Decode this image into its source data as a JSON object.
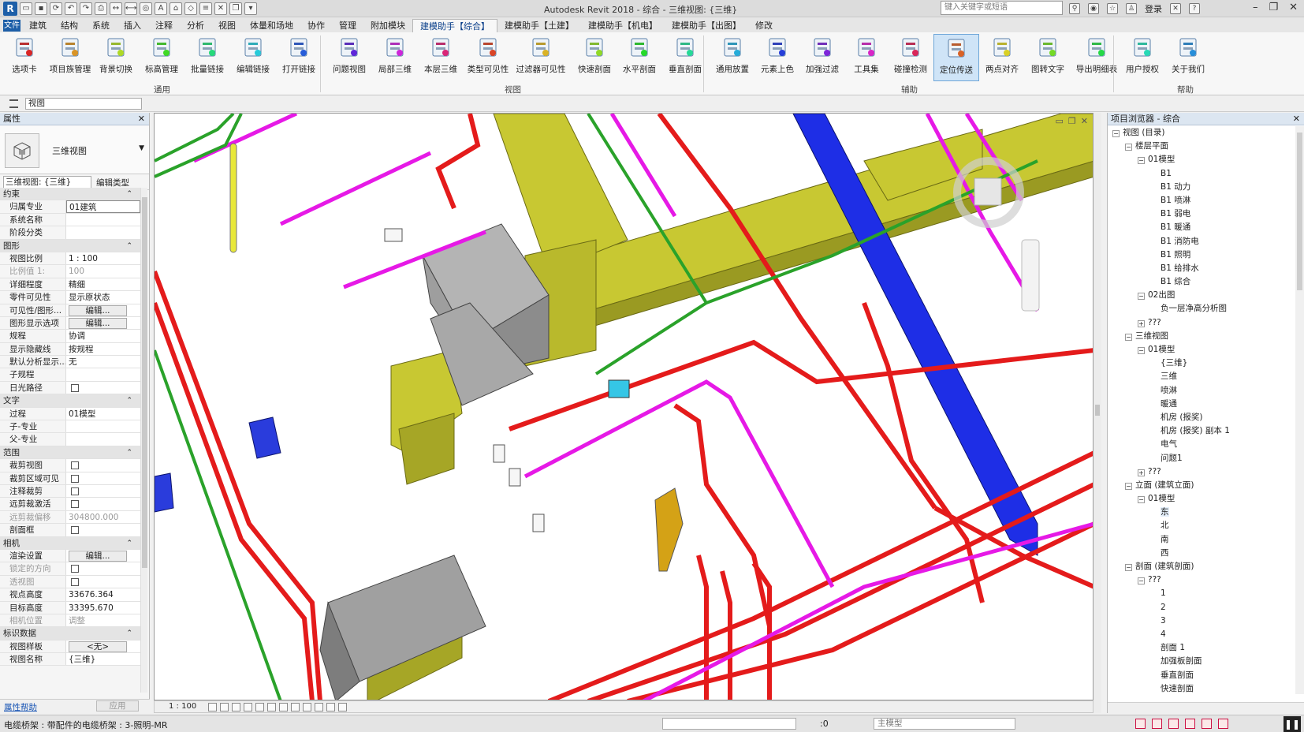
{
  "app": {
    "title": "Autodesk Revit 2018 -    综合 - 三维视图: {三维}",
    "search_placeholder": "键入关键字或短语",
    "login": "登录"
  },
  "tabs": [
    "建筑",
    "结构",
    "系统",
    "插入",
    "注释",
    "分析",
    "视图",
    "体量和场地",
    "协作",
    "管理",
    "附加模块",
    "建模助手【综合】",
    "建模助手【土建】",
    "建模助手【机电】",
    "建模助手【出图】",
    "修改"
  ],
  "active_tab": "建模助手【综合】",
  "ribbon": {
    "buttons": [
      {
        "label": "选项卡",
        "icon": "tab-icon"
      },
      {
        "label": "项目族管理",
        "icon": "family-manager-icon"
      },
      {
        "label": "背景切换",
        "icon": "background-switch-icon"
      },
      {
        "label": "标高管理",
        "icon": "level-manager-icon"
      },
      {
        "label": "批量链接",
        "icon": "batch-link-icon"
      },
      {
        "label": "编辑链接",
        "icon": "edit-link-icon"
      },
      {
        "label": "打开链接",
        "icon": "open-link-icon"
      },
      {
        "label": "问题视图",
        "icon": "issue-view-icon"
      },
      {
        "label": "局部三维",
        "icon": "local-3d-icon"
      },
      {
        "label": "本层三维",
        "icon": "floor-3d-icon"
      },
      {
        "label": "类型可见性",
        "icon": "type-visibility-icon"
      },
      {
        "label": "过滤器可见性",
        "icon": "filter-visibility-icon"
      },
      {
        "label": "快速剖面",
        "icon": "quick-section-icon"
      },
      {
        "label": "水平剖面",
        "icon": "horizontal-section-icon"
      },
      {
        "label": "垂直剖面",
        "icon": "vertical-section-icon"
      },
      {
        "label": "通用放置",
        "icon": "general-place-icon"
      },
      {
        "label": "元素上色",
        "icon": "element-color-icon"
      },
      {
        "label": "加强过滤",
        "icon": "enhanced-filter-icon"
      },
      {
        "label": "工具集",
        "icon": "toolbox-icon"
      },
      {
        "label": "碰撞检测",
        "icon": "clash-detect-icon"
      },
      {
        "label": "定位传送",
        "icon": "locate-teleport-icon"
      },
      {
        "label": "两点对齐",
        "icon": "two-point-align-icon"
      },
      {
        "label": "图转文字",
        "icon": "image-to-text-icon"
      },
      {
        "label": "导出明细表",
        "icon": "export-schedule-icon"
      },
      {
        "label": "用户授权",
        "icon": "user-license-icon"
      },
      {
        "label": "关于我们",
        "icon": "about-us-icon"
      }
    ],
    "active_button": "定位传送",
    "groups": [
      "通用",
      "视图",
      "辅助",
      "帮助"
    ]
  },
  "optionbar": {
    "view_select": "视图"
  },
  "properties": {
    "title": "属性",
    "type_name": "三维视图",
    "type_select": "三维视图: {三维}",
    "edit_type": "编辑类型",
    "rows": [
      {
        "section": "约束"
      },
      {
        "k": "归属专业",
        "v": "01建筑",
        "boxed": true
      },
      {
        "k": "系统名称",
        "v": ""
      },
      {
        "k": "阶段分类",
        "v": ""
      },
      {
        "section": "图形"
      },
      {
        "k": "视图比例",
        "v": "1 : 100"
      },
      {
        "k": "比例值 1:",
        "v": "100",
        "dis": true
      },
      {
        "k": "详细程度",
        "v": "精细"
      },
      {
        "k": "零件可见性",
        "v": "显示原状态"
      },
      {
        "k": "可见性/图形...",
        "btn": "编辑..."
      },
      {
        "k": "图形显示选项",
        "btn": "编辑..."
      },
      {
        "k": "规程",
        "v": "协调"
      },
      {
        "k": "显示隐藏线",
        "v": "按规程"
      },
      {
        "k": "默认分析显示...",
        "v": "无"
      },
      {
        "k": "子规程",
        "v": ""
      },
      {
        "k": "日光路径",
        "cb": true
      },
      {
        "section": "文字"
      },
      {
        "k": "过程",
        "v": "01模型"
      },
      {
        "k": "子-专业",
        "v": ""
      },
      {
        "k": "父-专业",
        "v": ""
      },
      {
        "section": "范围"
      },
      {
        "k": "裁剪视图",
        "cb": true
      },
      {
        "k": "裁剪区域可见",
        "cb": true
      },
      {
        "k": "注释裁剪",
        "cb": true
      },
      {
        "k": "远剪裁激活",
        "cb": true
      },
      {
        "k": "远剪裁偏移",
        "v": "304800.000",
        "dis": true
      },
      {
        "k": "剖面框",
        "cb": true
      },
      {
        "section": "相机"
      },
      {
        "k": "渲染设置",
        "btn": "编辑..."
      },
      {
        "k": "锁定的方向",
        "cb": true,
        "dis": true
      },
      {
        "k": "透视图",
        "cb": true,
        "dis": true
      },
      {
        "k": "视点高度",
        "v": "33676.364"
      },
      {
        "k": "目标高度",
        "v": "33395.670"
      },
      {
        "k": "相机位置",
        "v": "调整",
        "dis": true
      },
      {
        "section": "标识数据"
      },
      {
        "k": "视图样板",
        "btn": "<无>"
      },
      {
        "k": "视图名称",
        "v": "{三维}"
      }
    ],
    "help_link": "属性帮助",
    "apply": "应用"
  },
  "viewport": {
    "scale": "1 : 100"
  },
  "browser": {
    "title": "项目浏览器 - 综合",
    "nodes": [
      {
        "d": 0,
        "t": "-",
        "label": "视图 (目录)"
      },
      {
        "d": 1,
        "t": "-",
        "label": "楼层平面"
      },
      {
        "d": 2,
        "t": "-",
        "label": "01模型"
      },
      {
        "d": 3,
        "label": "B1"
      },
      {
        "d": 3,
        "label": "B1 动力"
      },
      {
        "d": 3,
        "label": "B1 喷淋"
      },
      {
        "d": 3,
        "label": "B1 弱电"
      },
      {
        "d": 3,
        "label": "B1 暖通"
      },
      {
        "d": 3,
        "label": "B1 消防电"
      },
      {
        "d": 3,
        "label": "B1 照明"
      },
      {
        "d": 3,
        "label": "B1 给排水"
      },
      {
        "d": 3,
        "label": "B1 综合"
      },
      {
        "d": 2,
        "t": "-",
        "label": "02出图"
      },
      {
        "d": 3,
        "label": "负一层净高分析图"
      },
      {
        "d": 2,
        "t": "+",
        "label": "???"
      },
      {
        "d": 1,
        "t": "-",
        "label": "三维视图"
      },
      {
        "d": 2,
        "t": "-",
        "label": "01模型"
      },
      {
        "d": 3,
        "label": "{三维}"
      },
      {
        "d": 3,
        "label": "三维"
      },
      {
        "d": 3,
        "label": "喷淋"
      },
      {
        "d": 3,
        "label": "暖通"
      },
      {
        "d": 3,
        "label": "机房 (报奖)"
      },
      {
        "d": 3,
        "label": "机房 (报奖)  副本 1"
      },
      {
        "d": 3,
        "label": "电气"
      },
      {
        "d": 3,
        "label": "问题1"
      },
      {
        "d": 2,
        "t": "+",
        "label": "???"
      },
      {
        "d": 1,
        "t": "-",
        "label": "立面 (建筑立面)"
      },
      {
        "d": 2,
        "t": "-",
        "label": "01模型"
      },
      {
        "d": 3,
        "label": "东",
        "sel": true
      },
      {
        "d": 3,
        "label": "北"
      },
      {
        "d": 3,
        "label": "南"
      },
      {
        "d": 3,
        "label": "西"
      },
      {
        "d": 1,
        "t": "-",
        "label": "剖面 (建筑剖面)"
      },
      {
        "d": 2,
        "t": "-",
        "label": "???"
      },
      {
        "d": 3,
        "label": "1"
      },
      {
        "d": 3,
        "label": "2"
      },
      {
        "d": 3,
        "label": "3"
      },
      {
        "d": 3,
        "label": "4"
      },
      {
        "d": 3,
        "label": "剖面 1"
      },
      {
        "d": 3,
        "label": "加强板剖面"
      },
      {
        "d": 3,
        "label": "垂直剖面"
      },
      {
        "d": 3,
        "label": "快速剖面"
      }
    ]
  },
  "statusbar": {
    "message": "电缆桥架 : 带配件的电缆桥架 : 3-照明-MR",
    "zero": ":0",
    "model": "主模型"
  },
  "colors": {
    "duct": "#c8c832",
    "fire_pipe": "#e41b1b",
    "pink_pipe": "#e619e6",
    "green_pipe": "#2aa22a",
    "blue_duct": "#1e2ee6",
    "equipment": "#a8a8a8"
  }
}
